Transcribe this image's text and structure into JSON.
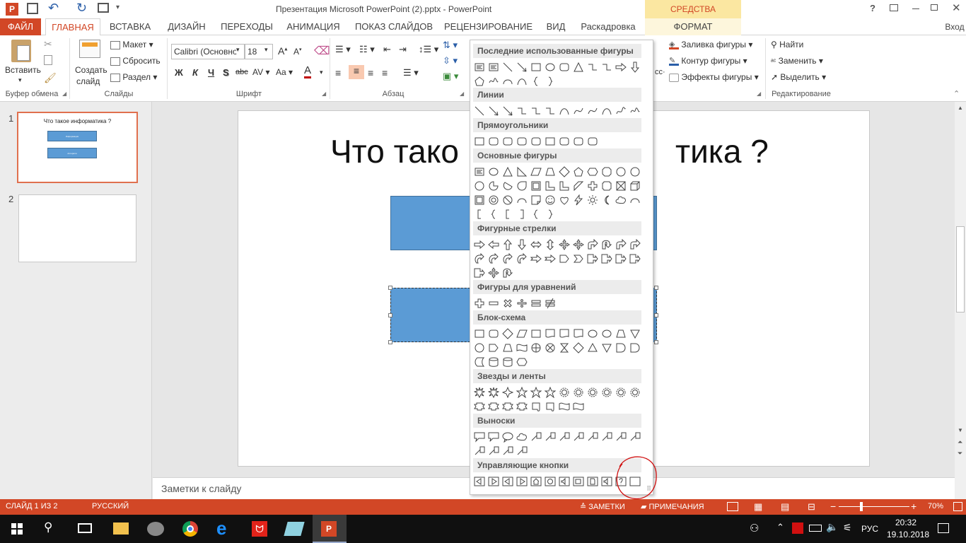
{
  "window": {
    "title": "Презентация Microsoft PowerPoint (2).pptx - PowerPoint",
    "contextual_group": "СРЕДСТВА РИСОВАНИЯ",
    "help": "?"
  },
  "tabs": [
    "ФАЙЛ",
    "ГЛАВНАЯ",
    "ВСТАВКА",
    "ДИЗАЙН",
    "ПЕРЕХОДЫ",
    "АНИМАЦИЯ",
    "ПОКАЗ СЛАЙДОВ",
    "РЕЦЕНЗИРОВАНИЕ",
    "ВИД",
    "Раскадровка",
    "ФОРМАТ"
  ],
  "signin": "Вход",
  "ribbon": {
    "paste": "Вставить",
    "new_slide_1": "Создать",
    "new_slide_2": "слайд",
    "layout": "Макет",
    "reset": "Сбросить",
    "section": "Раздел",
    "font_name": "Calibri (Основно",
    "font_size": "18",
    "bold": "Ж",
    "italic": "К",
    "underline": "Ч",
    "shadow": "S",
    "strike": "abc",
    "spacing": "AV",
    "case": "Aa",
    "fill": "Заливка фигуры",
    "outline": "Контур фигуры",
    "effects": "Эффекты фигуры",
    "find": "Найти",
    "replace": "Заменить",
    "select": "Выделить",
    "groups": {
      "clipboard": "Буфер обмена",
      "slides": "Слайды",
      "font": "Шрифт",
      "paragraph": "Абзац",
      "editing": "Редактирование"
    }
  },
  "thumbnails": [
    {
      "num": "1",
      "title": "Что такое информатика ?",
      "box1": "Информация",
      "box2": "Алгоритм"
    },
    {
      "num": "2"
    }
  ],
  "slide": {
    "title_left": "Что тако",
    "title_right": "тика ?"
  },
  "notes_placeholder": "Заметки к слайду",
  "gallery": {
    "categories": [
      "Последние использованные фигуры",
      "Линии",
      "Прямоугольники",
      "Основные фигуры",
      "Фигурные стрелки",
      "Фигуры для уравнений",
      "Блок-схема",
      "Звезды и ленты",
      "Выноски",
      "Управляющие кнопки"
    ]
  },
  "status": {
    "slide": "СЛАЙД 1 ИЗ 2",
    "lang": "РУССКИЙ",
    "notes": "ЗАМЕТКИ",
    "comments": "ПРИМЕЧАНИЯ",
    "zoom": "70%"
  },
  "taskbar": {
    "lang": "РУС",
    "time": "20:32",
    "date": "19.10.2018"
  },
  "colors": {
    "accent": "#d24726",
    "shape": "#5b9bd5",
    "contextual": "#fbe7a1"
  }
}
